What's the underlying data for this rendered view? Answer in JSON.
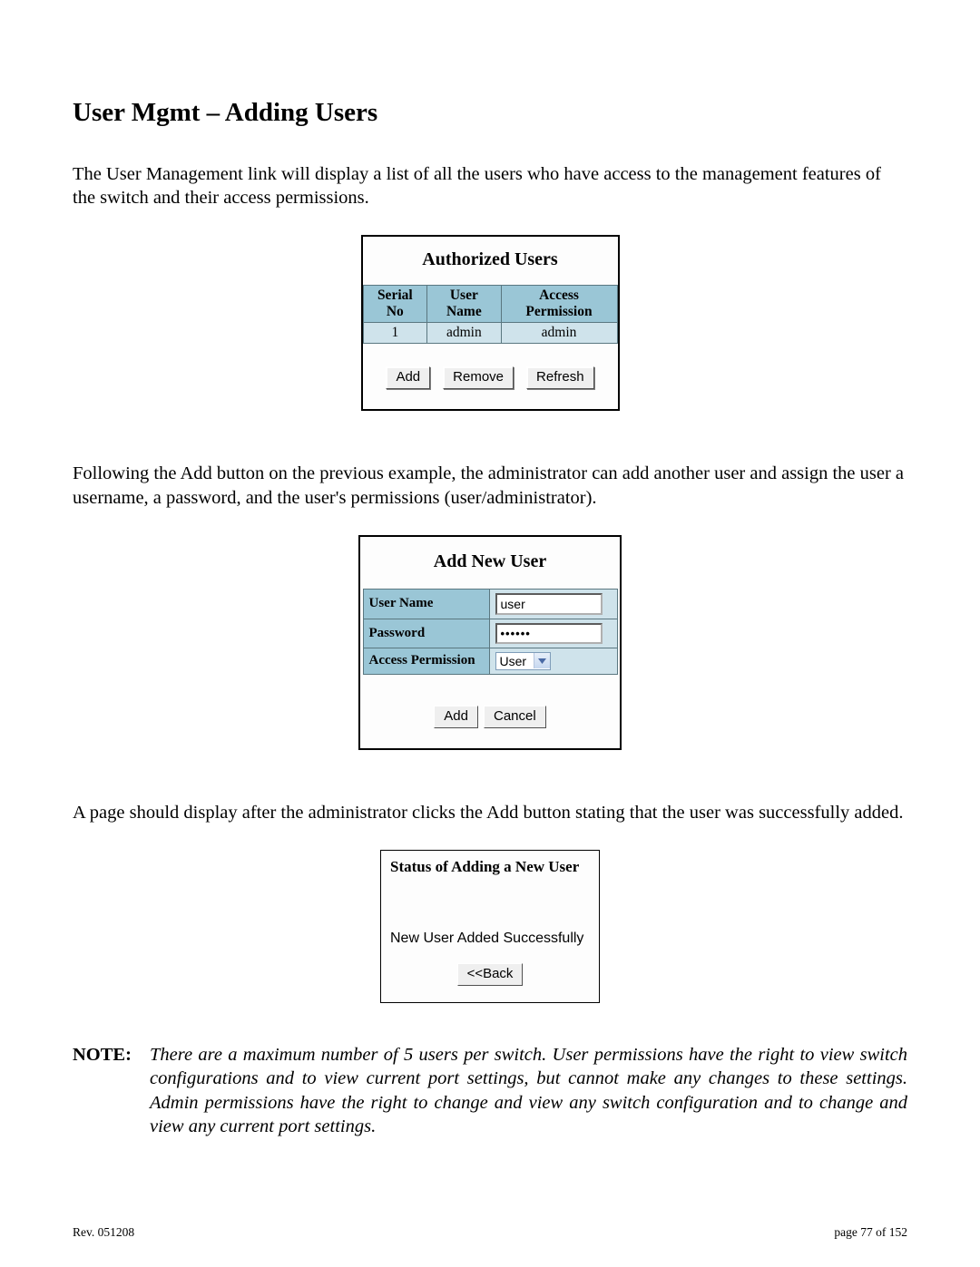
{
  "heading": "User Mgmt – Adding Users",
  "para1": "The User Management link will display a list of all the users who have access to the management features of the switch and their access permissions.",
  "auth_panel": {
    "title": "Authorized Users",
    "columns": [
      "Serial No",
      "User Name",
      "Access Permission"
    ],
    "rows": [
      {
        "serial": "1",
        "user": "admin",
        "perm": "admin"
      }
    ],
    "buttons": {
      "add": "Add",
      "remove": "Remove",
      "refresh": "Refresh"
    }
  },
  "para2": "Following the Add button on the previous example, the administrator can add another user and assign the user a username, a password, and the user's permissions (user/administrator).",
  "add_panel": {
    "title": "Add New User",
    "fields": {
      "username_label": "User Name",
      "username_value": "user",
      "password_label": "Password",
      "password_display": "••••••",
      "perm_label": "Access Permission",
      "perm_value": "User"
    },
    "buttons": {
      "add": "Add",
      "cancel": "Cancel"
    }
  },
  "para3": "A page should display after the administrator clicks the Add button stating that the user was successfully added.",
  "status_panel": {
    "title": "Status of Adding a New User",
    "message": "New User Added Successfully",
    "back": "<<Back"
  },
  "note": {
    "label": "NOTE:",
    "text": "There are a maximum number of 5 users per switch.  User permissions have the right to view switch configurations and to view current port settings, but cannot make any changes to these settings.  Admin permissions have the right to change and view any switch configuration and to change and view any current port settings."
  },
  "footer": {
    "rev": "Rev.  051208",
    "page": "page 77 of 152"
  }
}
